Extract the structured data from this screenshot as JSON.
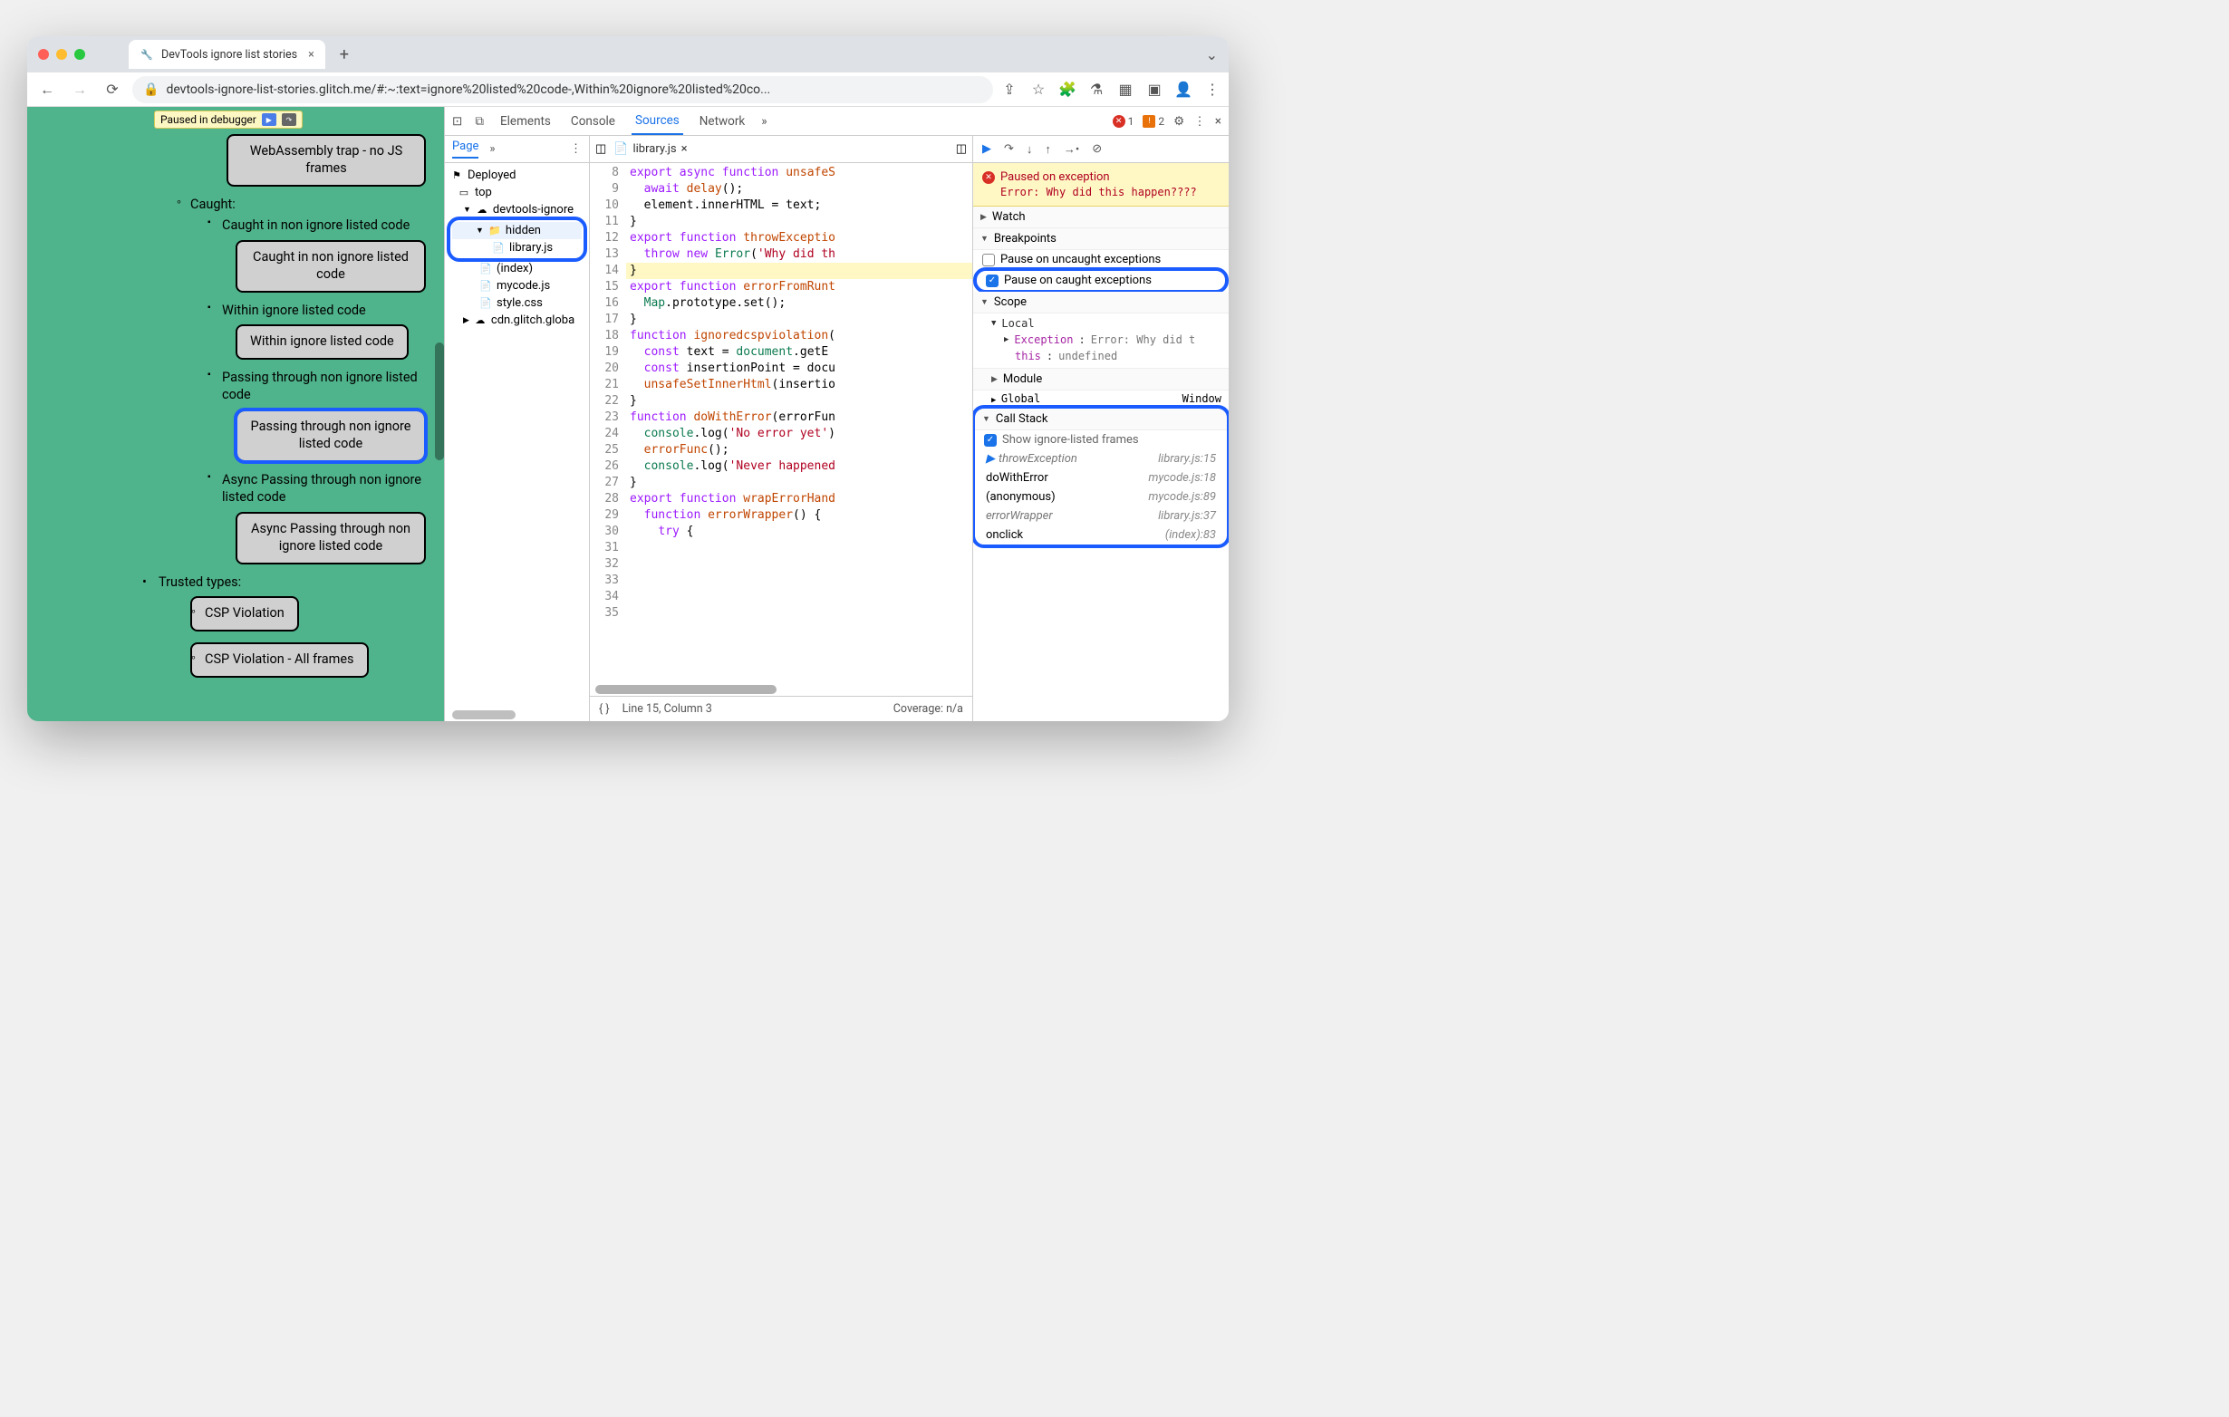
{
  "browserTab": {
    "title": "DevTools ignore list stories"
  },
  "url": "devtools-ignore-list-stories.glitch.me/#:~:text=ignore%20listed%20code-,Within%20ignore%20listed%20co...",
  "pausedBadge": "Paused in debugger",
  "page": {
    "wasmItem": "WebAssembly trap - no JS frames",
    "caughtHeader": "Caught:",
    "items": [
      {
        "label": "Caught in non ignore listed code",
        "button": "Caught in non ignore listed code"
      },
      {
        "label": "Within ignore listed code",
        "button": "Within ignore listed code"
      },
      {
        "label": "Passing through non ignore listed code",
        "button": "Passing through non ignore listed code",
        "highlight": true
      },
      {
        "label": "Async Passing through non ignore listed code",
        "button": "Async Passing through non ignore listed code"
      }
    ],
    "trustedHeader": "Trusted types:",
    "trustedItems": [
      "CSP Violation",
      "CSP Violation - All frames"
    ]
  },
  "devtools": {
    "tabs": [
      "Elements",
      "Console",
      "Sources",
      "Network"
    ],
    "activeTab": "Sources",
    "errors": 1,
    "warnings": 2,
    "navigator": {
      "tab": "Page",
      "deployed": "Deployed",
      "top": "top",
      "domain": "devtools-ignore",
      "folder": "hidden",
      "file": "library.js",
      "index": "(index)",
      "mycode": "mycode.js",
      "style": "style.css",
      "cdn": "cdn.glitch.globa"
    },
    "editor": {
      "fileName": "library.js",
      "lineStart": 8,
      "status": {
        "line": "Line 15, Column 3",
        "coverage": "Coverage: n/a"
      },
      "code": [
        "export async function unsafeS",
        "  await delay();",
        "  element.innerHTML = text;",
        "}",
        "",
        "export function throwExceptio",
        "  throw new Error('Why did th",
        "}",
        "",
        "export function errorFromRunt",
        "  Map.prototype.set();",
        "}",
        "",
        "function ignoredcspviolation(",
        "  const text = document.getE",
        "  const insertionPoint = docu",
        "  unsafeSetInnerHtml(insertio",
        "}",
        "",
        "function doWithError(errorFun",
        "  console.log('No error yet')",
        "  errorFunc();",
        "  console.log('Never happened",
        "}",
        "",
        "export function wrapErrorHand",
        "  function errorWrapper() {",
        "    try {"
      ]
    },
    "debugger": {
      "pausedTitle": "Paused on exception",
      "pausedError": "Error: Why did this happen????",
      "watch": "Watch",
      "breakpoints": "Breakpoints",
      "bpUncaught": "Pause on uncaught exceptions",
      "bpCaught": "Pause on caught exceptions",
      "scope": "Scope",
      "local": "Local",
      "exception": "Exception",
      "exceptionVal": "Error: Why did t",
      "thisLabel": "this",
      "thisVal": "undefined",
      "module": "Module",
      "global": "Global",
      "globalVal": "Window",
      "callStack": "Call Stack",
      "showIgnored": "Show ignore-listed frames",
      "stack": [
        {
          "fn": "throwException",
          "loc": "library.js:15",
          "current": true,
          "ignored": true
        },
        {
          "fn": "doWithError",
          "loc": "mycode.js:18"
        },
        {
          "fn": "(anonymous)",
          "loc": "mycode.js:89"
        },
        {
          "fn": "errorWrapper",
          "loc": "library.js:37",
          "ignored": true
        },
        {
          "fn": "onclick",
          "loc": "(index):83"
        }
      ]
    }
  }
}
